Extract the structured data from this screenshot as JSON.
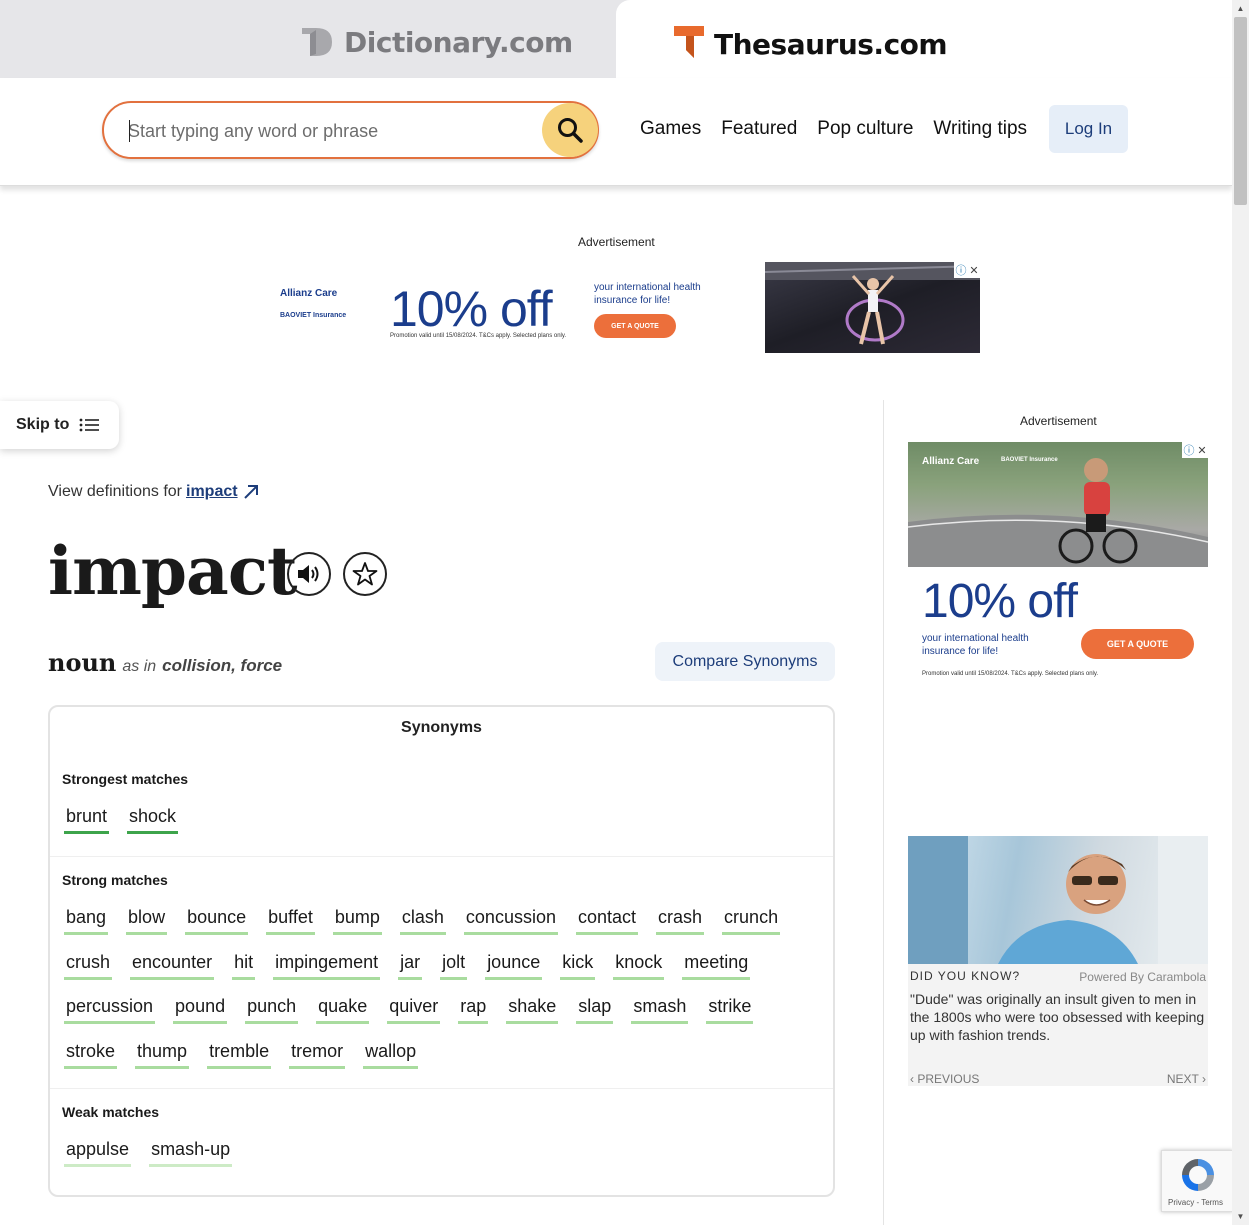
{
  "brands": {
    "dictionary": "Dictionary.com",
    "thesaurus": "Thesaurus.com"
  },
  "search": {
    "placeholder": "Start typing any word or phrase"
  },
  "nav": {
    "items": [
      "Games",
      "Featured",
      "Pop culture",
      "Writing tips"
    ],
    "login": "Log In"
  },
  "ads": {
    "label": "Advertisement",
    "top": {
      "brand1": "Allianz Care",
      "brand2": "BAOVIET Insurance",
      "headline": "10% off",
      "tagline": "your international health insurance for life!",
      "cta": "GET A QUOTE",
      "fine": "Promotion valid until 15/08/2024. T&Cs apply. Selected plans only."
    },
    "side": {
      "brand1": "Allianz Care",
      "brand2": "BAOVIET Insurance",
      "headline": "10% off",
      "tagline": "your international health insurance for life!",
      "cta": "GET A QUOTE",
      "fine": "Promotion valid until 15/08/2024. T&Cs apply. Selected plans only."
    }
  },
  "skip": {
    "label": "Skip to"
  },
  "entry": {
    "view_def_prefix": "View definitions for",
    "view_def_word": "impact",
    "headword": "impact",
    "pos": "noun",
    "as_in": "as in",
    "sense": "collision, force",
    "compare": "Compare Synonyms"
  },
  "synonyms": {
    "title": "Synonyms",
    "strongest_label": "Strongest matches",
    "strongest": [
      "brunt",
      "shock"
    ],
    "strong_label": "Strong matches",
    "strong": [
      "bang",
      "blow",
      "bounce",
      "buffet",
      "bump",
      "clash",
      "concussion",
      "contact",
      "crash",
      "crunch",
      "crush",
      "encounter",
      "hit",
      "impingement",
      "jar",
      "jolt",
      "jounce",
      "kick",
      "knock",
      "meeting",
      "percussion",
      "pound",
      "punch",
      "quake",
      "quiver",
      "rap",
      "shake",
      "slap",
      "smash",
      "strike",
      "stroke",
      "thump",
      "tremble",
      "tremor",
      "wallop"
    ],
    "weak_label": "Weak matches",
    "weak": [
      "appulse",
      "smash-up"
    ]
  },
  "did_you_know": {
    "heading": "DID YOU KNOW?",
    "powered_by": "Powered By Carambola",
    "text": "\"Dude\" was originally an insult given to men in the 1800s who were too obsessed with keeping up with fashion trends.",
    "prev": "PREVIOUS",
    "next": "NEXT"
  },
  "recaptcha": {
    "legal": "Privacy - Terms"
  },
  "colors": {
    "accent_orange": "#e2713e",
    "search_button": "#f6d27c",
    "link_blue": "#1d3d7a",
    "strongest_underline": "#3da44b",
    "strong_underline": "#a9dc9f"
  }
}
